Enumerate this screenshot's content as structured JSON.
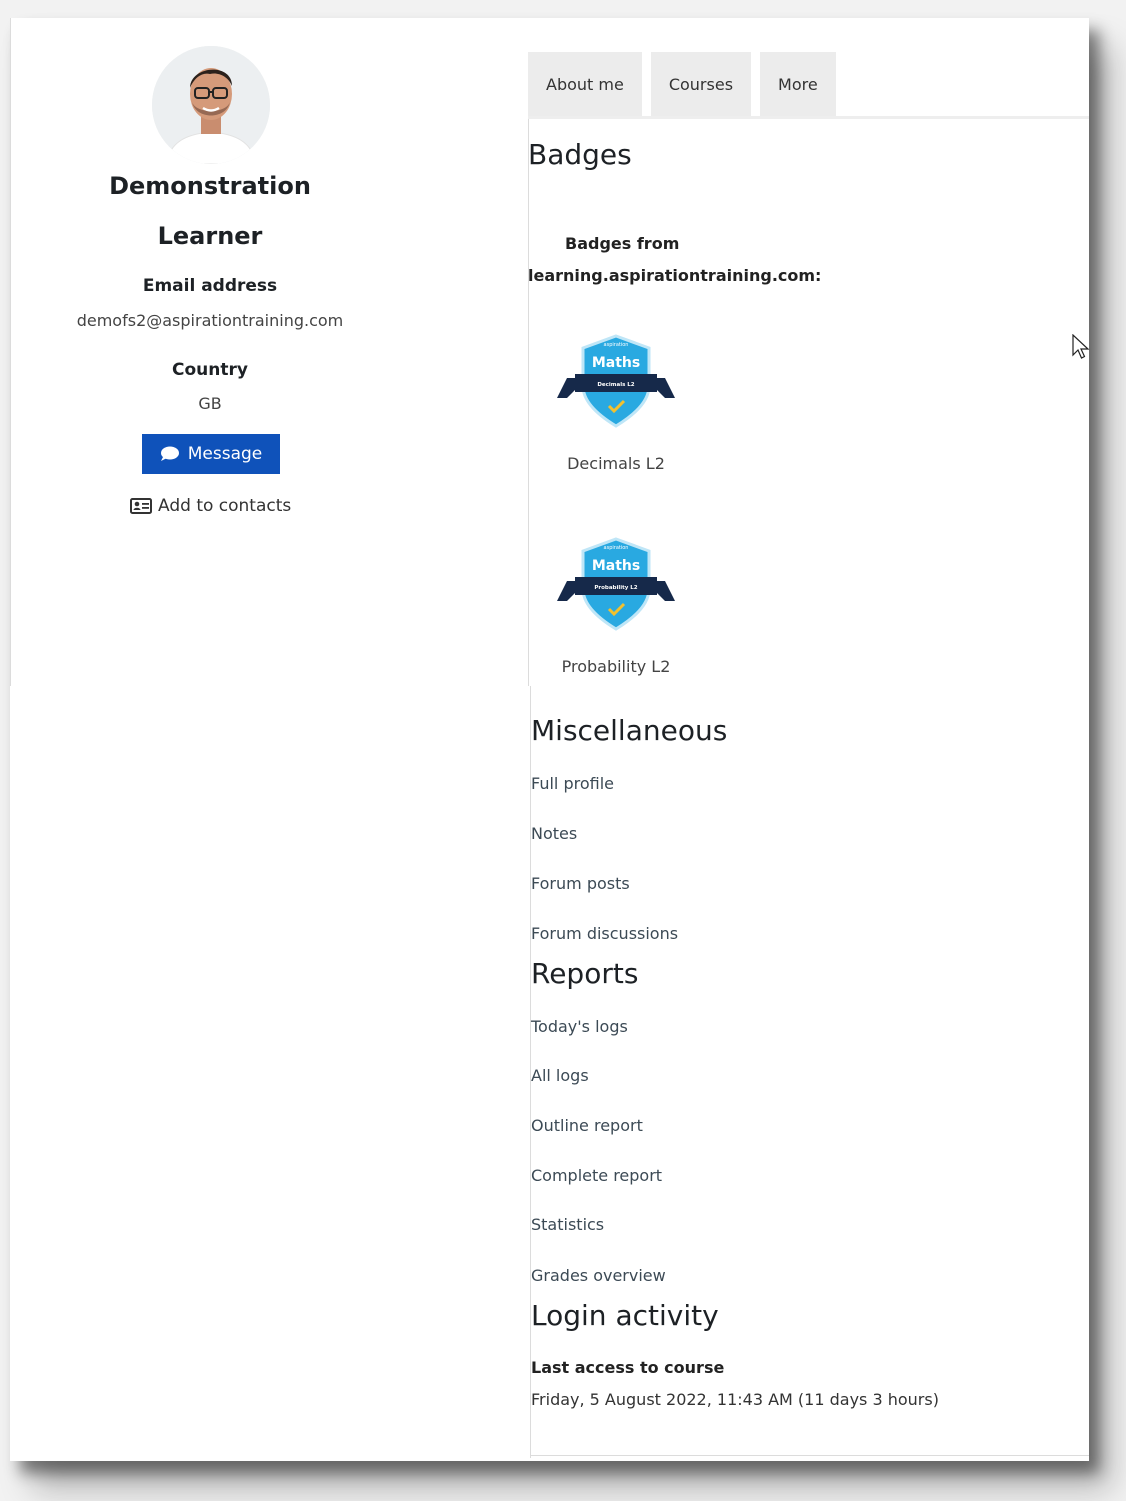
{
  "profile": {
    "name_line1": "Demonstration",
    "name_line2": "Learner",
    "email_label": "Email address",
    "email": "demofs2@aspirationtraining.com",
    "country_label": "Country",
    "country": "GB",
    "message_label": "Message",
    "add_contacts_label": "Add to contacts"
  },
  "tabs": [
    {
      "label": "About me"
    },
    {
      "label": "Courses"
    },
    {
      "label": "More"
    }
  ],
  "badges": {
    "title": "Badges",
    "from_line1": "Badges from",
    "from_line2": "learning.aspirationtraining.com:",
    "items": [
      {
        "name": "Decimals  L2",
        "badge_brand": "aspiration",
        "badge_title": "Maths",
        "badge_subtitle": "Decimals L2"
      },
      {
        "name": "Probability  L2",
        "badge_brand": "aspiration",
        "badge_title": "Maths",
        "badge_subtitle": "Probability L2"
      }
    ]
  },
  "miscellaneous": {
    "title": "Miscellaneous",
    "links": [
      "Full profile",
      "Notes",
      "Forum posts",
      "Forum discussions"
    ]
  },
  "reports": {
    "title": "Reports",
    "links": [
      "Today's logs",
      "All logs",
      "Outline report",
      "Complete report",
      "Statistics",
      "Grades overview"
    ]
  },
  "login_activity": {
    "title": "Login activity",
    "last_access_label": "Last access to course",
    "last_access_value": "Friday, 5 August 2022, 11:43 AM  (11 days 3 hours)"
  },
  "colors": {
    "accent": "#0f52ba",
    "badge_blue": "#29a9e1",
    "badge_navy": "#16294a",
    "badge_check": "#f2c12e"
  }
}
